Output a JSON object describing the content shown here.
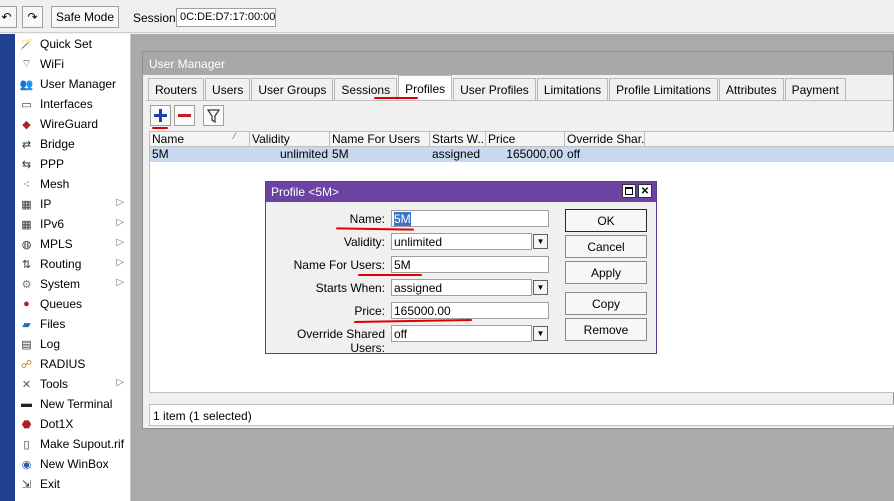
{
  "toolbar": {
    "safe_mode_label": "Safe Mode",
    "session_label": "Session:",
    "session_value": "0C:DE:D7:17:00:00"
  },
  "sidebar": {
    "items": [
      {
        "label": "Quick Set",
        "icon": "wand-icon",
        "submenu": false
      },
      {
        "label": "WiFi",
        "icon": "wifi-icon",
        "submenu": false
      },
      {
        "label": "User Manager",
        "icon": "users-icon",
        "submenu": false
      },
      {
        "label": "Interfaces",
        "icon": "interfaces-icon",
        "submenu": false
      },
      {
        "label": "WireGuard",
        "icon": "wireguard-icon",
        "submenu": false
      },
      {
        "label": "Bridge",
        "icon": "bridge-icon",
        "submenu": false
      },
      {
        "label": "PPP",
        "icon": "ppp-icon",
        "submenu": false
      },
      {
        "label": "Mesh",
        "icon": "mesh-icon",
        "submenu": false
      },
      {
        "label": "IP",
        "icon": "ip-icon",
        "submenu": true
      },
      {
        "label": "IPv6",
        "icon": "ipv6-icon",
        "submenu": true
      },
      {
        "label": "MPLS",
        "icon": "mpls-icon",
        "submenu": true
      },
      {
        "label": "Routing",
        "icon": "routing-icon",
        "submenu": true
      },
      {
        "label": "System",
        "icon": "gear-icon",
        "submenu": true
      },
      {
        "label": "Queues",
        "icon": "queues-icon",
        "submenu": false
      },
      {
        "label": "Files",
        "icon": "folder-icon",
        "submenu": false
      },
      {
        "label": "Log",
        "icon": "log-icon",
        "submenu": false
      },
      {
        "label": "RADIUS",
        "icon": "radius-icon",
        "submenu": false
      },
      {
        "label": "Tools",
        "icon": "tools-icon",
        "submenu": true
      },
      {
        "label": "New Terminal",
        "icon": "terminal-icon",
        "submenu": false
      },
      {
        "label": "Dot1X",
        "icon": "dot1x-icon",
        "submenu": false
      },
      {
        "label": "Make Supout.rif",
        "icon": "document-icon",
        "submenu": false
      },
      {
        "label": "New WinBox",
        "icon": "winbox-icon",
        "submenu": false
      },
      {
        "label": "Exit",
        "icon": "exit-icon",
        "submenu": false
      }
    ]
  },
  "user_manager": {
    "title": "User Manager",
    "tabs": [
      "Routers",
      "Users",
      "User Groups",
      "Sessions",
      "Profiles",
      "User Profiles",
      "Limitations",
      "Profile Limitations",
      "Attributes",
      "Payment"
    ],
    "active_tab": "Profiles",
    "table": {
      "columns": [
        "Name",
        "Validity",
        "Name For Users",
        "Starts W...",
        "Price",
        "Override Shar..."
      ],
      "rows": [
        {
          "name": "5M",
          "validity": "unlimited",
          "name_for_users": "5M",
          "starts_when": "assigned",
          "price": "165000.00",
          "override": "off"
        }
      ]
    },
    "status": "1 item (1 selected)"
  },
  "dialog": {
    "title": "Profile <5M>",
    "fields": {
      "name_label": "Name:",
      "name_value": "5M",
      "validity_label": "Validity:",
      "validity_value": "unlimited",
      "nfu_label": "Name For Users:",
      "nfu_value": "5M",
      "starts_label": "Starts When:",
      "starts_value": "assigned",
      "price_label": "Price:",
      "price_value": "165000.00",
      "override_label": "Override Shared Users:",
      "override_value": "off"
    },
    "buttons": {
      "ok": "OK",
      "cancel": "Cancel",
      "apply": "Apply",
      "copy": "Copy",
      "remove": "Remove"
    }
  },
  "colors": {
    "dialog_title": "#6b43a2",
    "selection": "#c7d8ef",
    "annotation": "#e00000",
    "add_icon": "#1a3fb0",
    "remove_icon": "#c02020"
  }
}
